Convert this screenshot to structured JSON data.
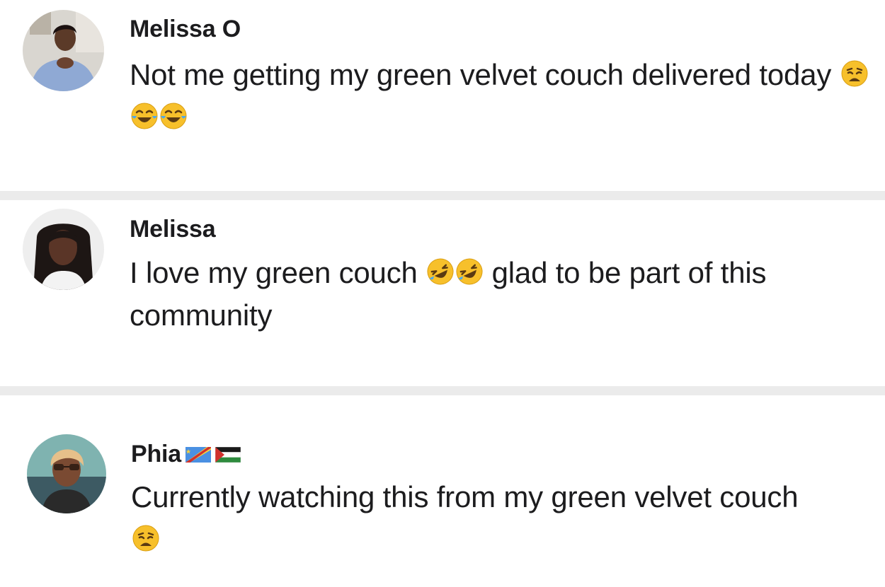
{
  "comments": [
    {
      "username": "Melissa O",
      "text_parts": [
        "Not me getting my green velvet couch delivered today ",
        ""
      ],
      "emojis": [
        "weary-face",
        "tears-of-joy",
        "tears-of-joy"
      ]
    },
    {
      "username": "Melissa",
      "text_before": "I love my green couch ",
      "text_after": " glad to be part of this community",
      "emojis": [
        "rolling-on-floor-laughing",
        "rolling-on-floor-laughing"
      ]
    },
    {
      "username": "Phia",
      "flags": [
        "dr-congo-flag",
        "palestine-flag"
      ],
      "text": "Currently watching this from my green velvet couch",
      "emojis": [
        "weary-face"
      ]
    }
  ],
  "colors": {
    "text": "#1c1c1e",
    "divider": "#ebebeb",
    "background": "#ffffff",
    "emoji_yellow": "#f7c02b",
    "emoji_tears": "#4fa8e8"
  }
}
